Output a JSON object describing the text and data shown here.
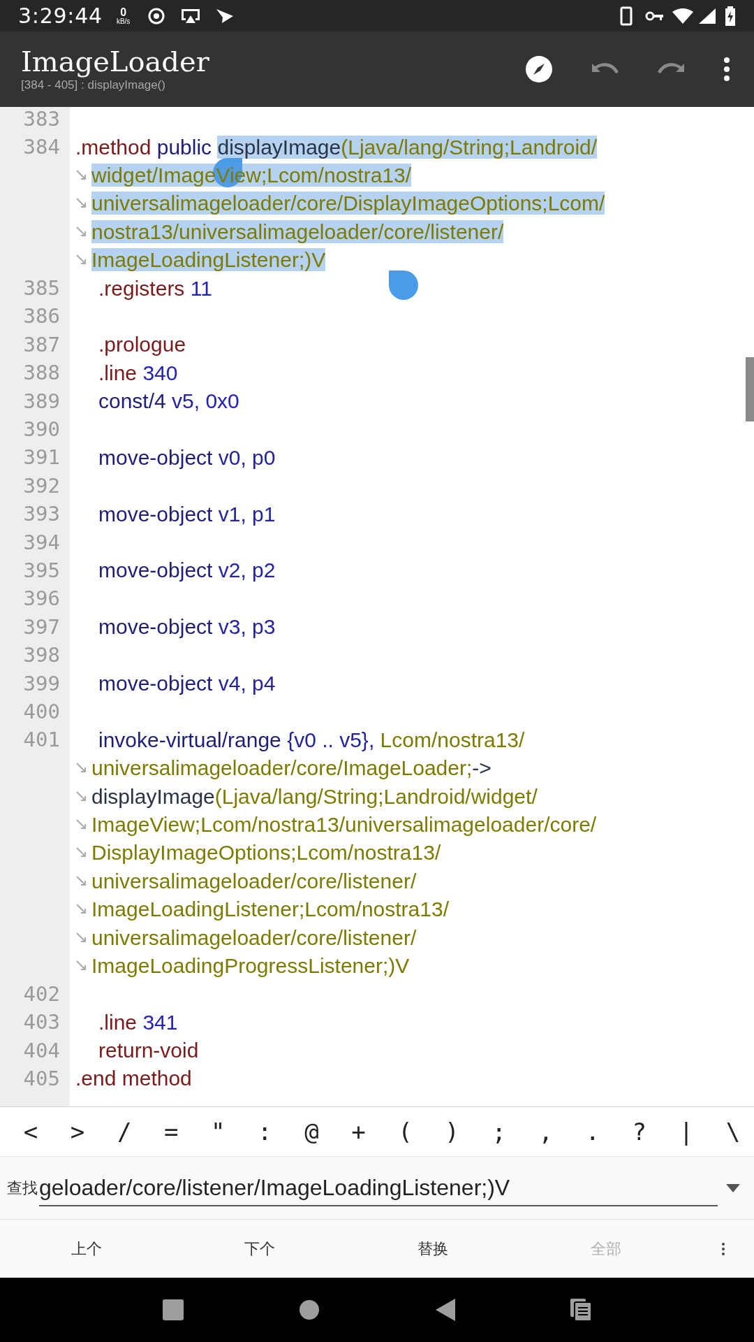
{
  "status_bar": {
    "time": "3:29:44",
    "net_speed": "0",
    "net_unit": "kB/s"
  },
  "toolbar": {
    "title": "ImageLoader",
    "subtitle": "[384 - 405] : displayImage()",
    "actions": [
      {
        "kind": "compass",
        "disabled": false
      },
      {
        "kind": "undo",
        "disabled": true
      },
      {
        "kind": "redo",
        "disabled": true
      },
      {
        "kind": "more",
        "disabled": false
      }
    ]
  },
  "code": {
    "lines": [
      {
        "number": "383"
      },
      {
        "number": "384",
        "indented": false,
        "rows": [
          [
            {
              "kind": "directive",
              "text": ".method ",
              "selected": false
            },
            {
              "kind": "keyword",
              "text": "public ",
              "selected": false
            },
            {
              "kind": "name",
              "text": "displayImage",
              "selected": true
            },
            {
              "kind": "type",
              "text": "(Ljava/lang/String;Landroid/",
              "selected": true
            }
          ],
          [
            {
              "kind": "type",
              "text": "widget/ImageView;Lcom/nostra13/",
              "selected": true
            }
          ],
          [
            {
              "kind": "type",
              "text": "universalimageloader/core/DisplayImageOptions;Lcom/",
              "selected": true
            }
          ],
          [
            {
              "kind": "type",
              "text": "nostra13/universalimageloader/core/listener/",
              "selected": true
            }
          ],
          [
            {
              "kind": "type",
              "text": "ImageLoadingListener;)V",
              "selected": true
            }
          ]
        ]
      },
      {
        "number": "385",
        "indented": true,
        "rows": [
          [
            {
              "kind": "directive",
              "text": ".registers "
            },
            {
              "kind": "number",
              "text": "11"
            }
          ]
        ]
      },
      {
        "number": "386"
      },
      {
        "number": "387",
        "indented": true,
        "rows": [
          [
            {
              "kind": "directive",
              "text": ".prologue"
            }
          ]
        ]
      },
      {
        "number": "388",
        "indented": true,
        "rows": [
          [
            {
              "kind": "directive",
              "text": ".line "
            },
            {
              "kind": "number",
              "text": "340"
            }
          ]
        ]
      },
      {
        "number": "389",
        "indented": true,
        "rows": [
          [
            {
              "kind": "keyword",
              "text": "const/4 "
            },
            {
              "kind": "register",
              "text": "v5, "
            },
            {
              "kind": "number",
              "text": "0x0"
            }
          ]
        ]
      },
      {
        "number": "390"
      },
      {
        "number": "391",
        "indented": true,
        "rows": [
          [
            {
              "kind": "keyword",
              "text": "move-object "
            },
            {
              "kind": "register",
              "text": "v0, p0"
            }
          ]
        ]
      },
      {
        "number": "392"
      },
      {
        "number": "393",
        "indented": true,
        "rows": [
          [
            {
              "kind": "keyword",
              "text": "move-object "
            },
            {
              "kind": "register",
              "text": "v1, p1"
            }
          ]
        ]
      },
      {
        "number": "394"
      },
      {
        "number": "395",
        "indented": true,
        "rows": [
          [
            {
              "kind": "keyword",
              "text": "move-object "
            },
            {
              "kind": "register",
              "text": "v2, p2"
            }
          ]
        ]
      },
      {
        "number": "396"
      },
      {
        "number": "397",
        "indented": true,
        "rows": [
          [
            {
              "kind": "keyword",
              "text": "move-object "
            },
            {
              "kind": "register",
              "text": "v3, p3"
            }
          ]
        ]
      },
      {
        "number": "398"
      },
      {
        "number": "399",
        "indented": true,
        "rows": [
          [
            {
              "kind": "keyword",
              "text": "move-object "
            },
            {
              "kind": "register",
              "text": "v4, p4"
            }
          ]
        ]
      },
      {
        "number": "400"
      },
      {
        "number": "401",
        "indented": true,
        "rows": [
          [
            {
              "kind": "keyword",
              "text": "invoke-virtual/range "
            },
            {
              "kind": "register",
              "text": "{v0 .. v5}, "
            },
            {
              "kind": "type",
              "text": "Lcom/nostra13/"
            }
          ],
          [
            {
              "kind": "type",
              "text": "universalimageloader/core/ImageLoader;"
            },
            {
              "kind": "name",
              "text": "->"
            }
          ],
          [
            {
              "kind": "name",
              "text": "displayImage"
            },
            {
              "kind": "type",
              "text": "(Ljava/lang/String;Landroid/widget/"
            }
          ],
          [
            {
              "kind": "type",
              "text": "ImageView;Lcom/nostra13/universalimageloader/core/"
            }
          ],
          [
            {
              "kind": "type",
              "text": "DisplayImageOptions;Lcom/nostra13/"
            }
          ],
          [
            {
              "kind": "type",
              "text": "universalimageloader/core/listener/"
            }
          ],
          [
            {
              "kind": "type",
              "text": "ImageLoadingListener;Lcom/nostra13/"
            }
          ],
          [
            {
              "kind": "type",
              "text": "universalimageloader/core/listener/"
            }
          ],
          [
            {
              "kind": "type",
              "text": "ImageLoadingProgressListener;)V"
            }
          ]
        ]
      },
      {
        "number": "402"
      },
      {
        "number": "403",
        "indented": true,
        "rows": [
          [
            {
              "kind": "directive",
              "text": ".line "
            },
            {
              "kind": "number",
              "text": "341"
            }
          ]
        ]
      },
      {
        "number": "404",
        "indented": true,
        "rows": [
          [
            {
              "kind": "directive",
              "text": "return-void"
            }
          ]
        ]
      },
      {
        "number": "405",
        "indented": false,
        "rows": [
          [
            {
              "kind": "directive",
              "text": ".end method"
            }
          ]
        ]
      }
    ]
  },
  "symbol_keys": [
    "<",
    ">",
    "/",
    "=",
    "\"",
    ":",
    "@",
    "+",
    "(",
    ")",
    ";",
    ",",
    ".",
    "?",
    "|",
    "\\"
  ],
  "find_bar": {
    "label": "查找",
    "value": "geloader/core/listener/ImageLoadingListener;)V"
  },
  "find_buttons": [
    {
      "label": "上个",
      "disabled": false
    },
    {
      "label": "下个",
      "disabled": false
    },
    {
      "label": "替换",
      "disabled": false
    },
    {
      "label": "全部",
      "disabled": true
    }
  ]
}
